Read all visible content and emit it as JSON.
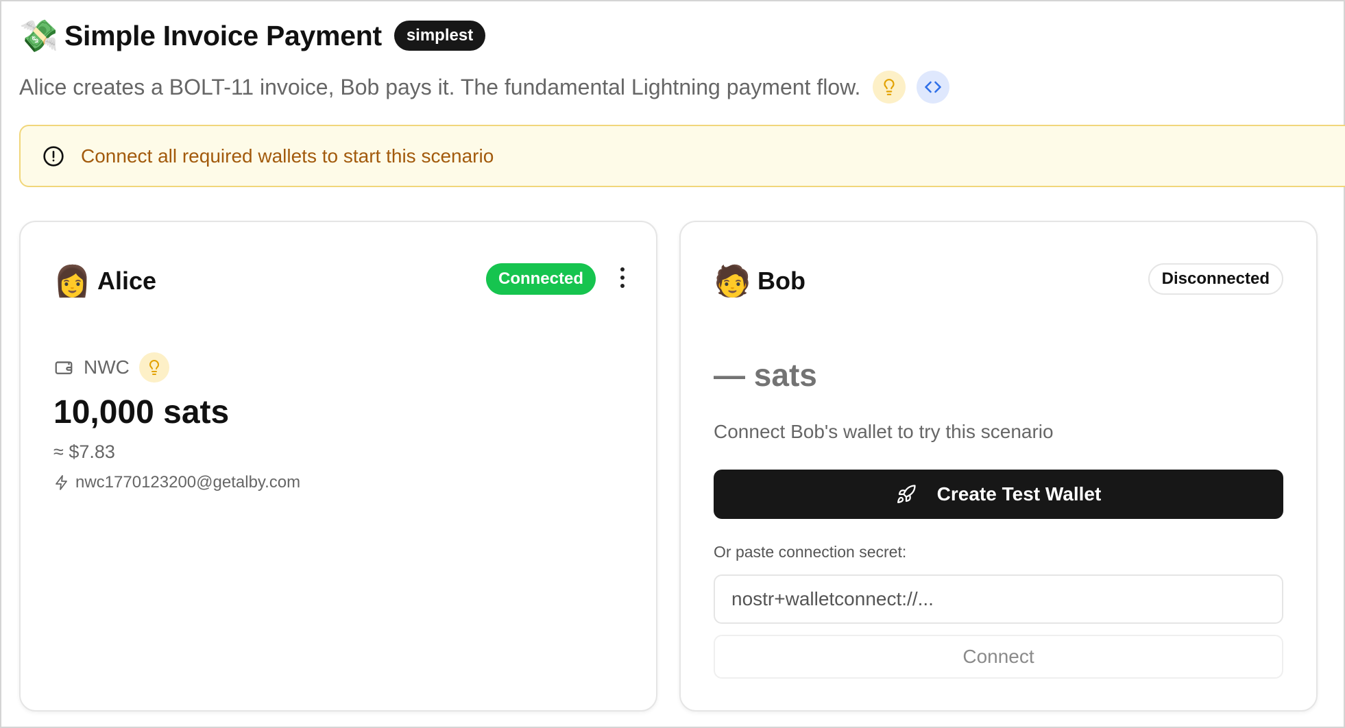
{
  "header": {
    "emoji": "💸",
    "title": "Simple Invoice Payment",
    "badge": "simplest",
    "subtitle": "Alice creates a BOLT-11 invoice, Bob pays it. The fundamental Lightning payment flow."
  },
  "alert": {
    "text": "Connect all required wallets to start this scenario"
  },
  "alice": {
    "avatar": "👩",
    "name": "Alice",
    "status": "Connected",
    "wallet_type": "NWC",
    "balance": "10,000 sats",
    "fiat": "≈ $7.83",
    "lightning_address": "nwc1770123200@getalby.com"
  },
  "bob": {
    "avatar": "🧑",
    "name": "Bob",
    "status": "Disconnected",
    "balance": "— sats",
    "hint": "Connect Bob's wallet to try this scenario",
    "create_button": "Create Test Wallet",
    "paste_label": "Or paste connection secret:",
    "secret_placeholder": "nostr+walletconnect://...",
    "connect_button": "Connect"
  },
  "colors": {
    "connected": "#16c44f",
    "alert_bg": "#fefbe8",
    "alert_text": "#a25a0c",
    "primary_button": "#171717"
  }
}
